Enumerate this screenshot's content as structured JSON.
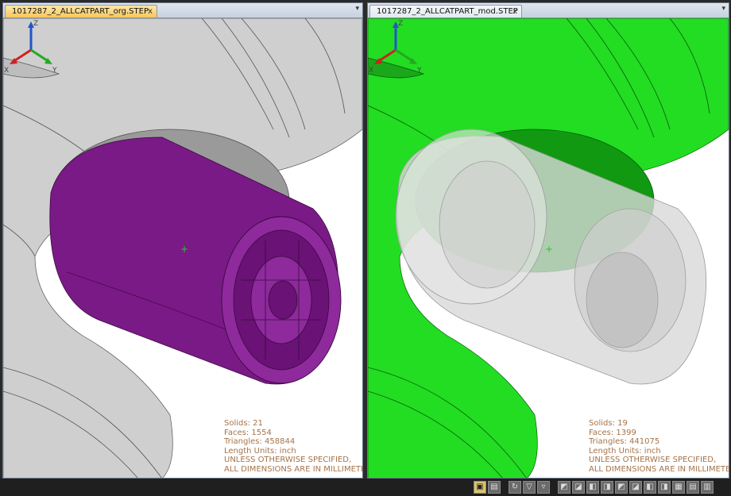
{
  "panels": {
    "left": {
      "tab_label": "1017287_2_ALLCATPART_org.STEP",
      "stats": {
        "solids": "Solids: 21",
        "faces": "Faces: 1554",
        "triangles": "Triangles: 458844",
        "units": "Length Units: inch",
        "note1": "UNLESS OTHERWISE SPECIFIED,",
        "note2": "ALL DIMENSIONS ARE IN MILLIMETERS"
      }
    },
    "right": {
      "tab_label": "1017287_2_ALLCATPART_mod.STEP",
      "stats": {
        "solids": "Solids: 19",
        "faces": "Faces: 1399",
        "triangles": "Triangles: 441075",
        "units": "Length Units: inch",
        "note1": "UNLESS OTHERWISE SPECIFIED,",
        "note2": "ALL DIMENSIONS ARE IN MILLIMETERS"
      }
    }
  },
  "triad": {
    "x": "X",
    "y": "Y",
    "z": "Z"
  },
  "tab_glyphs": {
    "close": "x",
    "menu": "▾"
  },
  "colors": {
    "housing_org": "#cfcfcf",
    "part_org": "#7a1a86",
    "housing_mod": "#22dd22",
    "part_mod": "#d8d8d8",
    "stats_text": "#a5734a",
    "tab_active": "#f6c65e"
  },
  "toolbar_icons": [
    "cube-icon",
    "box-icon",
    "rotate-icon",
    "filter-icon",
    "filter-icon",
    "view-iso-icon",
    "view-front-icon",
    "view-top-icon",
    "view-side-icon",
    "view-back-icon",
    "view-bottom-icon",
    "view-left-icon",
    "view-right-icon",
    "grid-icon",
    "box-icon",
    "box-icon"
  ]
}
